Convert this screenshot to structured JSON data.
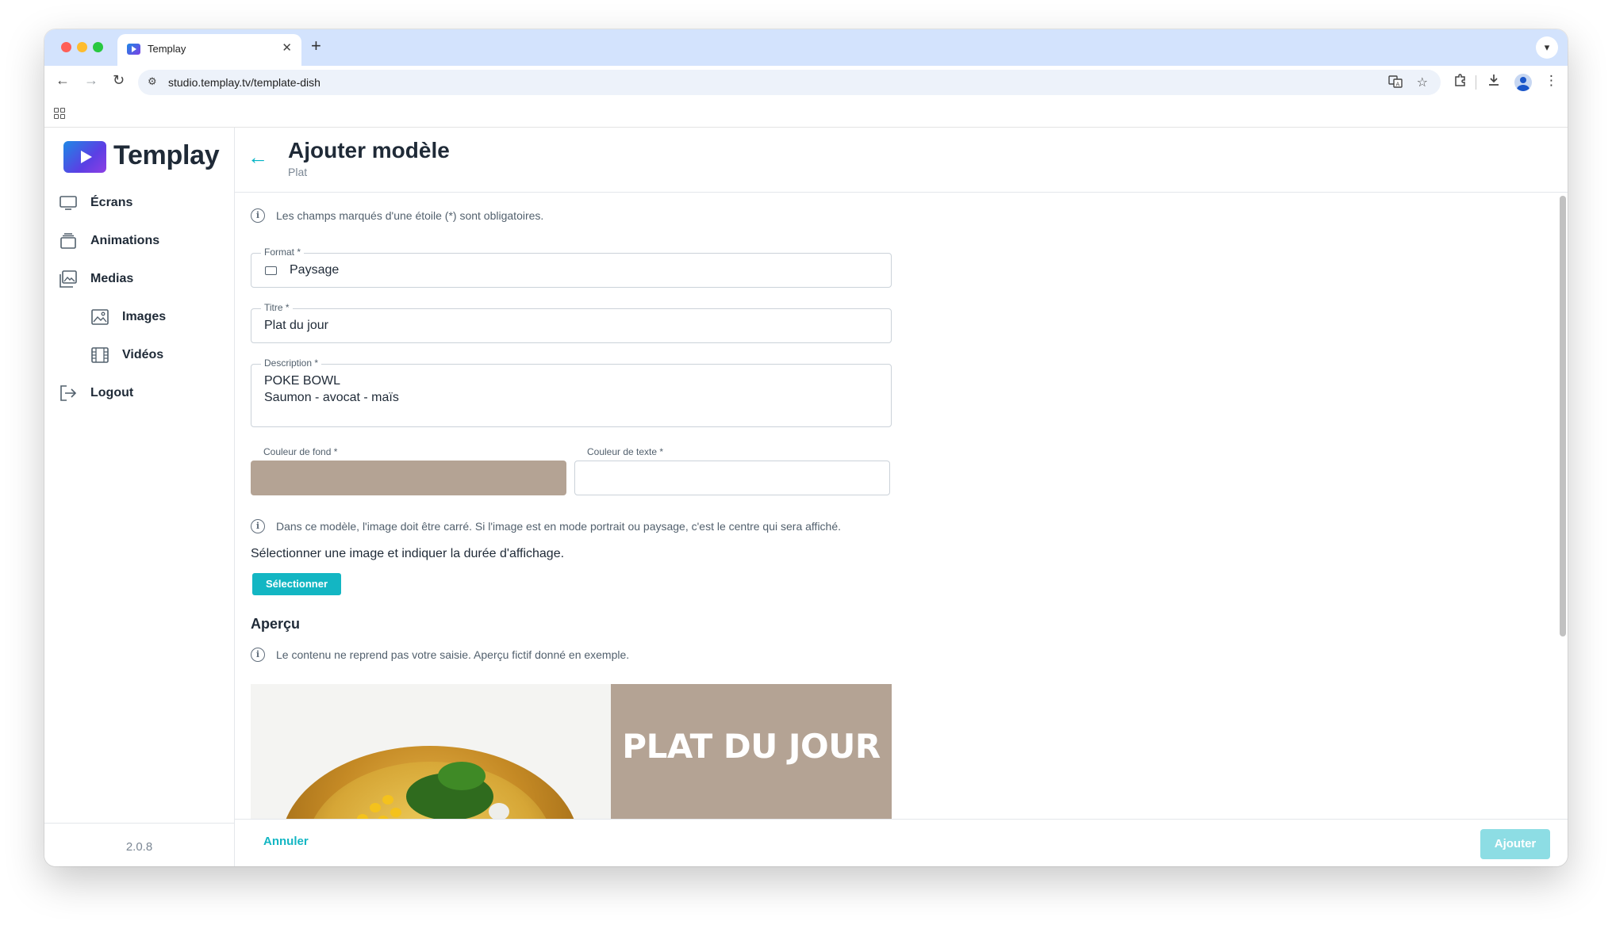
{
  "browser": {
    "tab_title": "Templay",
    "url": "studio.templay.tv/template-dish",
    "icons": {
      "back": "arrow-left-icon",
      "forward": "arrow-right-icon",
      "reload": "reload-icon",
      "site_settings": "tune-icon",
      "translate": "translate-icon",
      "bookmark": "star-icon",
      "extensions": "puzzle-icon",
      "downloads": "download-icon",
      "menu": "kebab-menu-icon"
    }
  },
  "sidebar": {
    "brand": "Templay",
    "items": [
      {
        "label": "Écrans",
        "icon": "monitor-icon"
      },
      {
        "label": "Animations",
        "icon": "layers-icon"
      },
      {
        "label": "Medias",
        "icon": "gallery-icon"
      },
      {
        "label": "Images",
        "icon": "image-icon"
      },
      {
        "label": "Vidéos",
        "icon": "film-icon"
      },
      {
        "label": "Logout",
        "icon": "logout-icon"
      }
    ],
    "version": "2.0.8"
  },
  "header": {
    "title": "Ajouter modèle",
    "subtitle": "Plat"
  },
  "form": {
    "required_notice": "Les champs marqués d'une étoile (*) sont obligatoires.",
    "format": {
      "label": "Format *",
      "value": "Paysage"
    },
    "title": {
      "label": "Titre *",
      "value": "Plat du jour"
    },
    "description": {
      "label": "Description *",
      "line1": "POKE BOWL",
      "line2": "Saumon - avocat - maïs"
    },
    "bg_color": {
      "label": "Couleur de fond *",
      "value": "#b4a394"
    },
    "text_color": {
      "label": "Couleur de texte *",
      "value": "#ffffff"
    },
    "image_notice": "Dans ce modèle, l'image doit être carré. Si l'image est en mode portrait ou paysage, c'est le centre qui sera affiché.",
    "select_prompt": "Sélectionner une image et indiquer la durée d'affichage.",
    "select_button": "Sélectionner"
  },
  "preview": {
    "title": "Aperçu",
    "notice": "Le contenu ne reprend pas votre saisie. Aperçu fictif donné en exemple.",
    "heading": "PLAT DU JOUR"
  },
  "footer": {
    "cancel": "Annuler",
    "submit": "Ajouter"
  },
  "colors": {
    "accent": "#13b6c3",
    "submit_disabled": "#8ddde4"
  }
}
